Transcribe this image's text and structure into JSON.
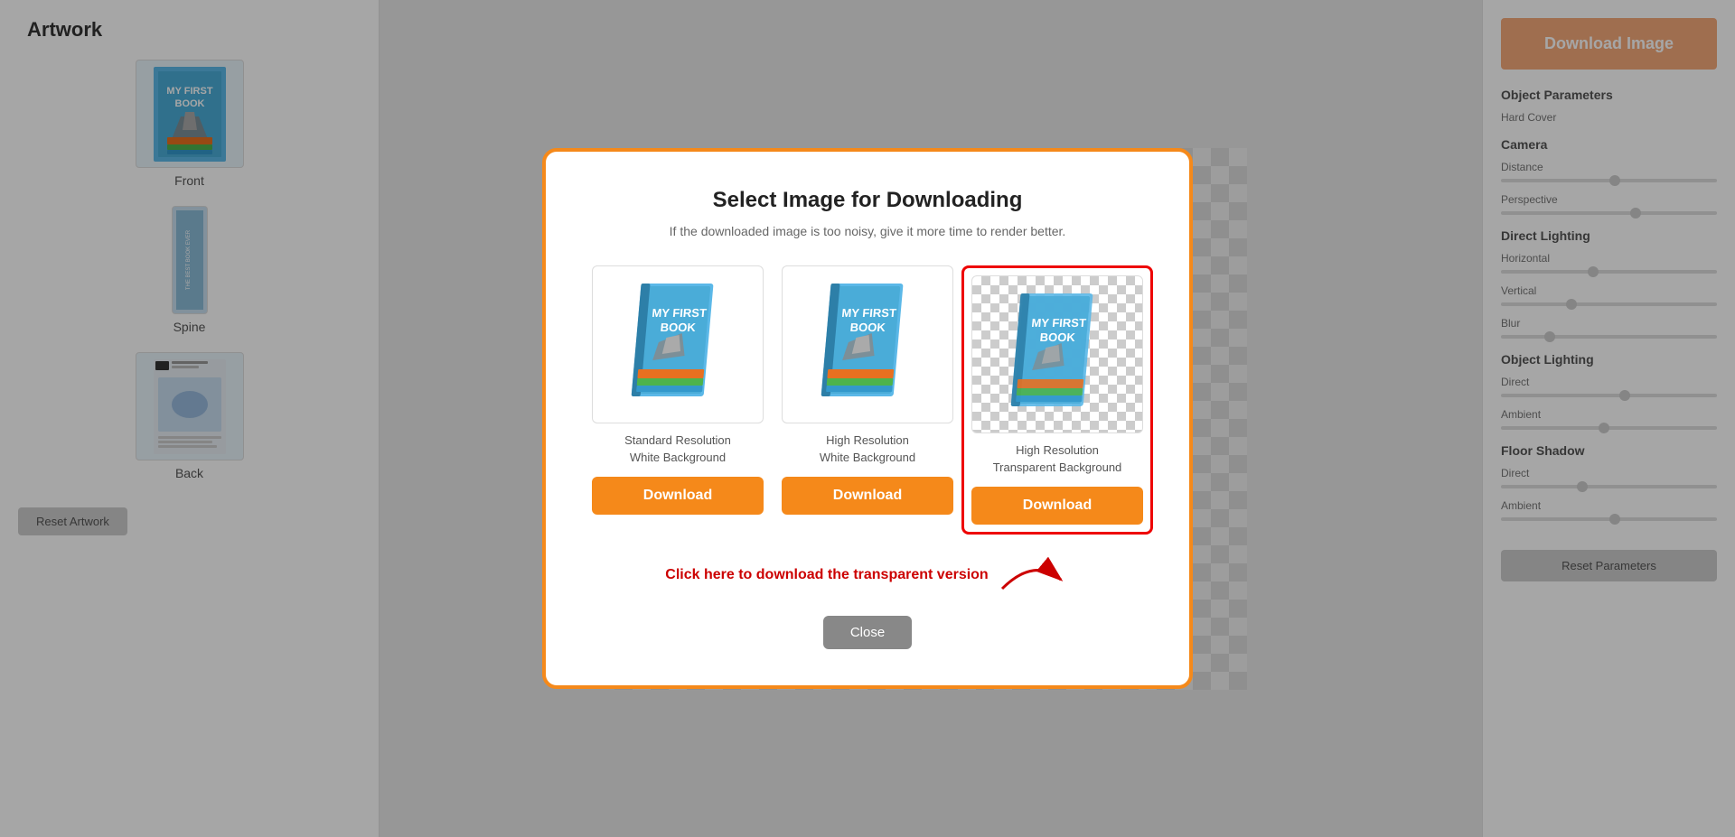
{
  "sidebar": {
    "title": "Artwork",
    "items": [
      {
        "label": "Front",
        "type": "front"
      },
      {
        "label": "Spine",
        "type": "spine"
      },
      {
        "label": "Back",
        "type": "back"
      }
    ],
    "reset_label": "Reset Artwork"
  },
  "header": {
    "download_image_label": "Download Image"
  },
  "right_panel": {
    "sections": [
      {
        "title": "Object Parameters"
      },
      {
        "subtitle": "Hard Cover"
      },
      {
        "title": "Camera"
      },
      {
        "subtitle": "Distance"
      },
      {
        "subtitle": "Perspective"
      },
      {
        "title": "Direct Lighting"
      },
      {
        "subtitle": "Horizontal"
      },
      {
        "subtitle": "Vertical"
      },
      {
        "subtitle": "Blur"
      },
      {
        "title": "Object Lighting"
      },
      {
        "subtitle": "Direct"
      },
      {
        "subtitle": "Ambient"
      },
      {
        "title": "Floor Shadow"
      },
      {
        "subtitle": "Direct"
      },
      {
        "subtitle": "Ambient"
      }
    ],
    "reset_params_label": "Reset Parameters"
  },
  "modal": {
    "title": "Select Image for Downloading",
    "subtitle": "If the downloaded image is too noisy, give it more time to render better.",
    "options": [
      {
        "id": "standard",
        "label_line1": "Standard Resolution",
        "label_line2": "White Background",
        "button_label": "Download",
        "highlighted": false
      },
      {
        "id": "high",
        "label_line1": "High Resolution",
        "label_line2": "White Background",
        "button_label": "Download",
        "highlighted": false
      },
      {
        "id": "transparent",
        "label_line1": "High Resolution",
        "label_line2": "Transparent Background",
        "button_label": "Download",
        "highlighted": true
      }
    ],
    "annotation_text": "Click here to download the transparent version",
    "close_label": "Close"
  }
}
